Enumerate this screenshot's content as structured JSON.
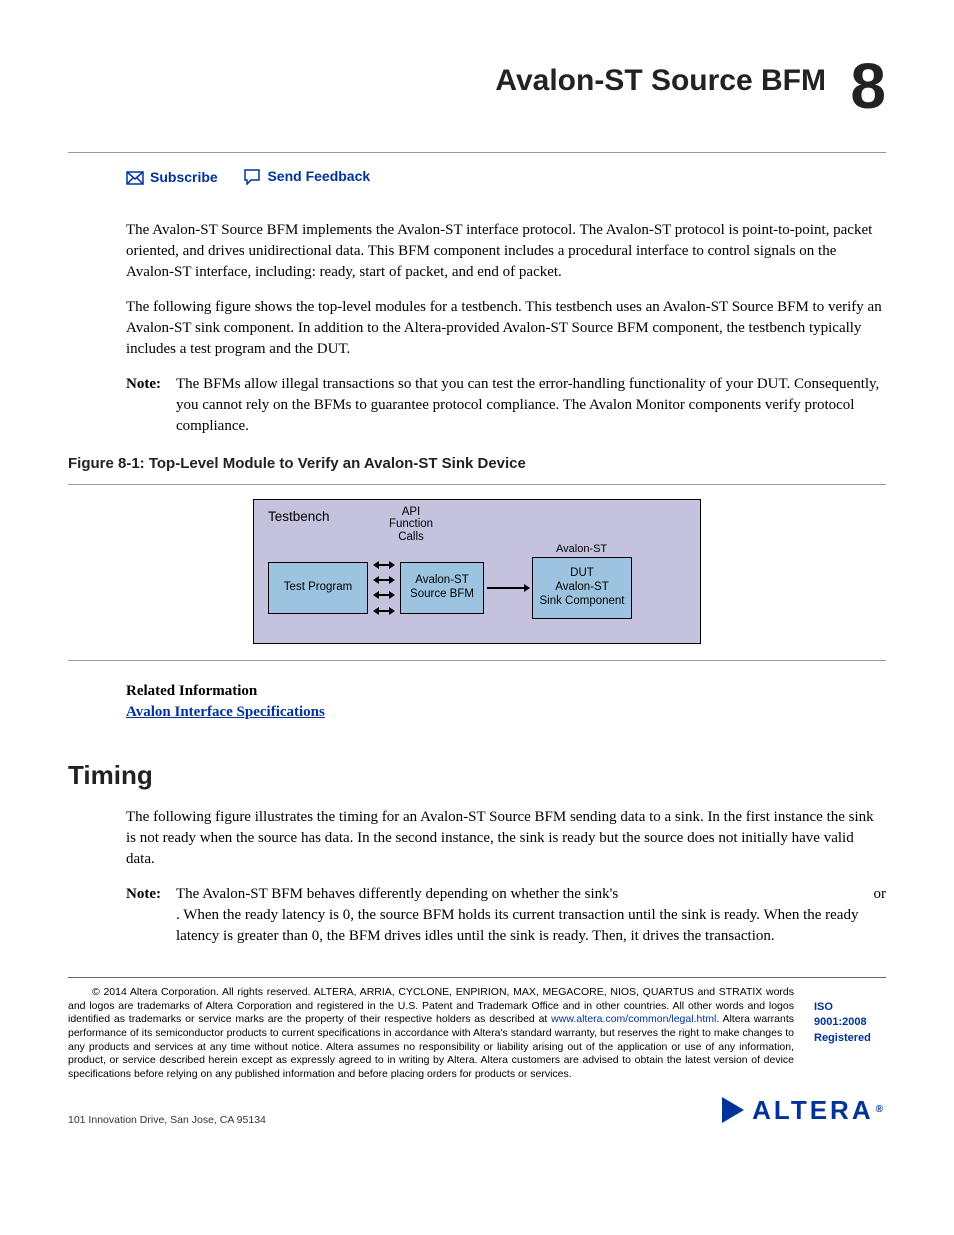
{
  "header": {
    "title": "Avalon-ST Source BFM",
    "chapter_number": "8"
  },
  "actions": {
    "subscribe": "Subscribe",
    "feedback": "Send Feedback"
  },
  "intro": {
    "p1": "The Avalon-ST Source BFM implements the Avalon-ST interface protocol. The Avalon-ST protocol is point-to-point, packet oriented, and drives unidirectional data. This BFM component includes a procedural interface to control signals on the Avalon-ST interface, including: ready, start of packet, and end of packet.",
    "p2": "The following figure shows the top-level modules for a testbench. This testbench uses an Avalon-ST Source BFM to verify an Avalon-ST sink component. In addition to the Altera-provided Avalon-ST Source BFM component, the testbench typically includes a test program and the DUT."
  },
  "note1": {
    "label": "Note:",
    "text": "The BFMs allow illegal transactions so that you can test the error-handling functionality of your DUT. Consequently, you cannot rely on the BFMs to guarantee protocol compliance. The Avalon Monitor components verify protocol compliance."
  },
  "figure": {
    "caption": "Figure 8-1: Top-Level Module to Verify an Avalon-ST Sink Device",
    "testbench_label": "Testbench",
    "api_label": "API Function Calls",
    "box1": "Test Program",
    "box2_l1": "Avalon-ST",
    "box2_l2": "Source BFM",
    "conn_label": "Avalon-ST",
    "box3_l1": "DUT",
    "box3_l2": "Avalon-ST",
    "box3_l3": "Sink Component"
  },
  "related": {
    "heading": "Related Information",
    "link": "Avalon Interface Specifications"
  },
  "timing": {
    "heading": "Timing",
    "p1": "The following figure illustrates the timing for an Avalon-ST Source BFM sending data to a sink. In the first instance the sink is not ready when the source has data. In the second instance, the sink is ready but the source does not initially have valid data.",
    "note_label": "Note:",
    "note_text_a": "The Avalon-ST BFM behaves differently depending on whether the sink's",
    "note_text_b": "or",
    "note_text_c": ". When the ready latency is 0, the source BFM holds its current transaction until the sink is ready. When the ready latency is greater than 0, the BFM drives idles until the sink is ready. Then, it drives the transaction."
  },
  "legal": {
    "copyright_symbol": "©",
    "text_a": " 2014 Altera Corporation. All rights reserved. ALTERA, ARRIA, CYCLONE, ENPIRION, MAX, MEGACORE, NIOS, QUARTUS and STRATIX words and logos are trademarks of Altera Corporation and registered in the U.S. Patent and Trademark Office and in other countries. All other words and logos identified as trademarks or service marks are the property of their respective holders as described at ",
    "link": "www.altera.com/common/legal.html",
    "text_b": ". Altera warrants performance of its semiconductor products to current specifications in accordance with Altera's standard warranty, but reserves the right to make changes to any products and services at any time without notice. Altera assumes no responsibility or liability arising out of the application or use of any information, product, or service described herein except as expressly agreed to in writing by Altera. Altera customers are advised to obtain the latest version of device specifications before relying on any published information and before placing orders for products or services.",
    "iso": "ISO 9001:2008 Registered"
  },
  "footer": {
    "address": "101 Innovation Drive, San Jose, CA 95134",
    "logo_text": "ALTERA",
    "logo_reg": "®"
  }
}
